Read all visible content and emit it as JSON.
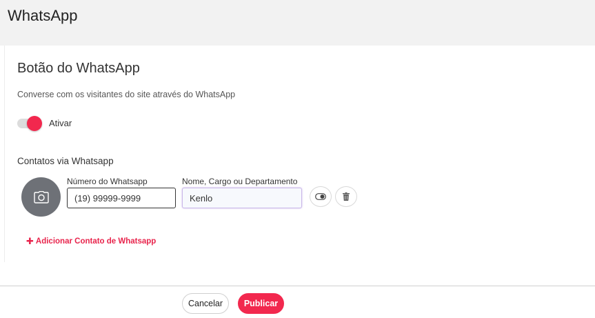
{
  "header": {
    "title": "WhatsApp"
  },
  "card": {
    "title": "Botão do WhatsApp",
    "description": "Converse com os visitantes do site através do WhatsApp",
    "toggle": {
      "label": "Ativar",
      "active": true
    },
    "contacts_section": {
      "title": "Contatos via Whatsapp",
      "contact": {
        "phone_label": "Número do Whatsapp",
        "phone_value": "(19) 99999-9999",
        "name_label": "Nome, Cargo ou Departamento",
        "name_value": "Kenlo"
      },
      "add_contact_label": "Adicionar Contato de Whatsapp"
    }
  },
  "footer": {
    "cancel_label": "Cancelar",
    "publish_label": "Publicar"
  },
  "colors": {
    "accent": "#f2284e",
    "avatar_bg": "#6e7177",
    "topbar_bg": "#f2f2f2"
  },
  "icons": {
    "avatar": "camera-icon",
    "toggle_contact": "toggle-icon",
    "delete_contact": "trash-icon",
    "add": "plus-icon"
  }
}
